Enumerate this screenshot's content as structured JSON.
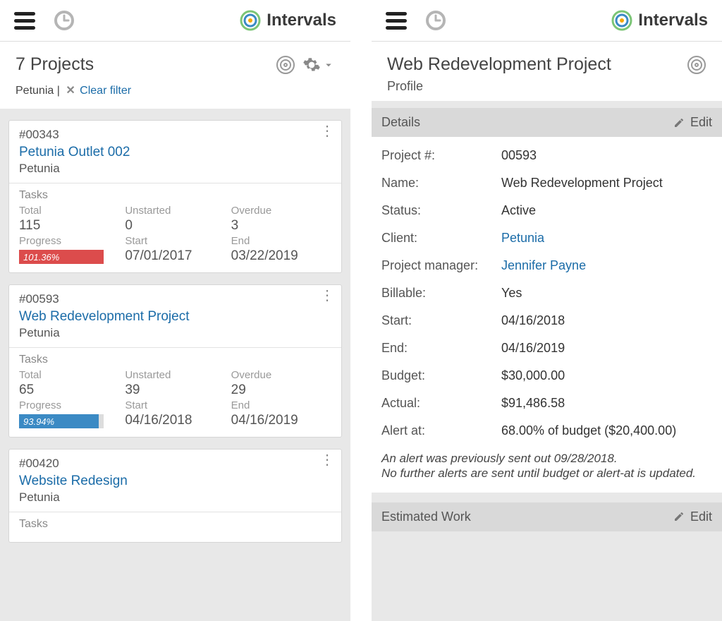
{
  "brand": "Intervals",
  "left": {
    "title": "7 Projects",
    "filter_name": "Petunia",
    "filter_sep": " | ",
    "clear_filter_label": "Clear filter",
    "labels": {
      "tasks": "Tasks",
      "total": "Total",
      "unstarted": "Unstarted",
      "overdue": "Overdue",
      "progress": "Progress",
      "start": "Start",
      "end": "End"
    },
    "projects": [
      {
        "id": "#00343",
        "name": "Petunia Outlet 002",
        "client": "Petunia",
        "total": "115",
        "unstarted": "0",
        "overdue": "3",
        "progress_text": "101.36%",
        "progress_pct": 100,
        "progress_color": "red",
        "start": "07/01/2017",
        "end": "03/22/2019"
      },
      {
        "id": "#00593",
        "name": "Web Redevelopment Project",
        "client": "Petunia",
        "total": "65",
        "unstarted": "39",
        "overdue": "29",
        "progress_text": "93.94%",
        "progress_pct": 94,
        "progress_color": "blue",
        "start": "04/16/2018",
        "end": "04/16/2019"
      },
      {
        "id": "#00420",
        "name": "Website Redesign",
        "client": "Petunia"
      }
    ]
  },
  "right": {
    "title": "Web Redevelopment Project",
    "subtitle": "Profile",
    "section_details": "Details",
    "section_estimated": "Estimated Work",
    "edit_label": "Edit",
    "rows": {
      "project_no_label": "Project #:",
      "project_no": "00593",
      "name_label": "Name:",
      "name": "Web Redevelopment Project",
      "status_label": "Status:",
      "status": "Active",
      "client_label": "Client:",
      "client": "Petunia",
      "pm_label": "Project manager:",
      "pm": "Jennifer Payne",
      "billable_label": "Billable:",
      "billable": "Yes",
      "start_label": "Start:",
      "start": "04/16/2018",
      "end_label": "End:",
      "end": "04/16/2019",
      "budget_label": "Budget:",
      "budget": "$30,000.00",
      "actual_label": "Actual:",
      "actual": "$91,486.58",
      "alert_label": "Alert at:",
      "alert": "68.00% of budget ($20,400.00)"
    },
    "alert_note_1": "An alert was previously sent out 09/28/2018.",
    "alert_note_2": "No further alerts are sent until budget or alert-at is updated."
  }
}
